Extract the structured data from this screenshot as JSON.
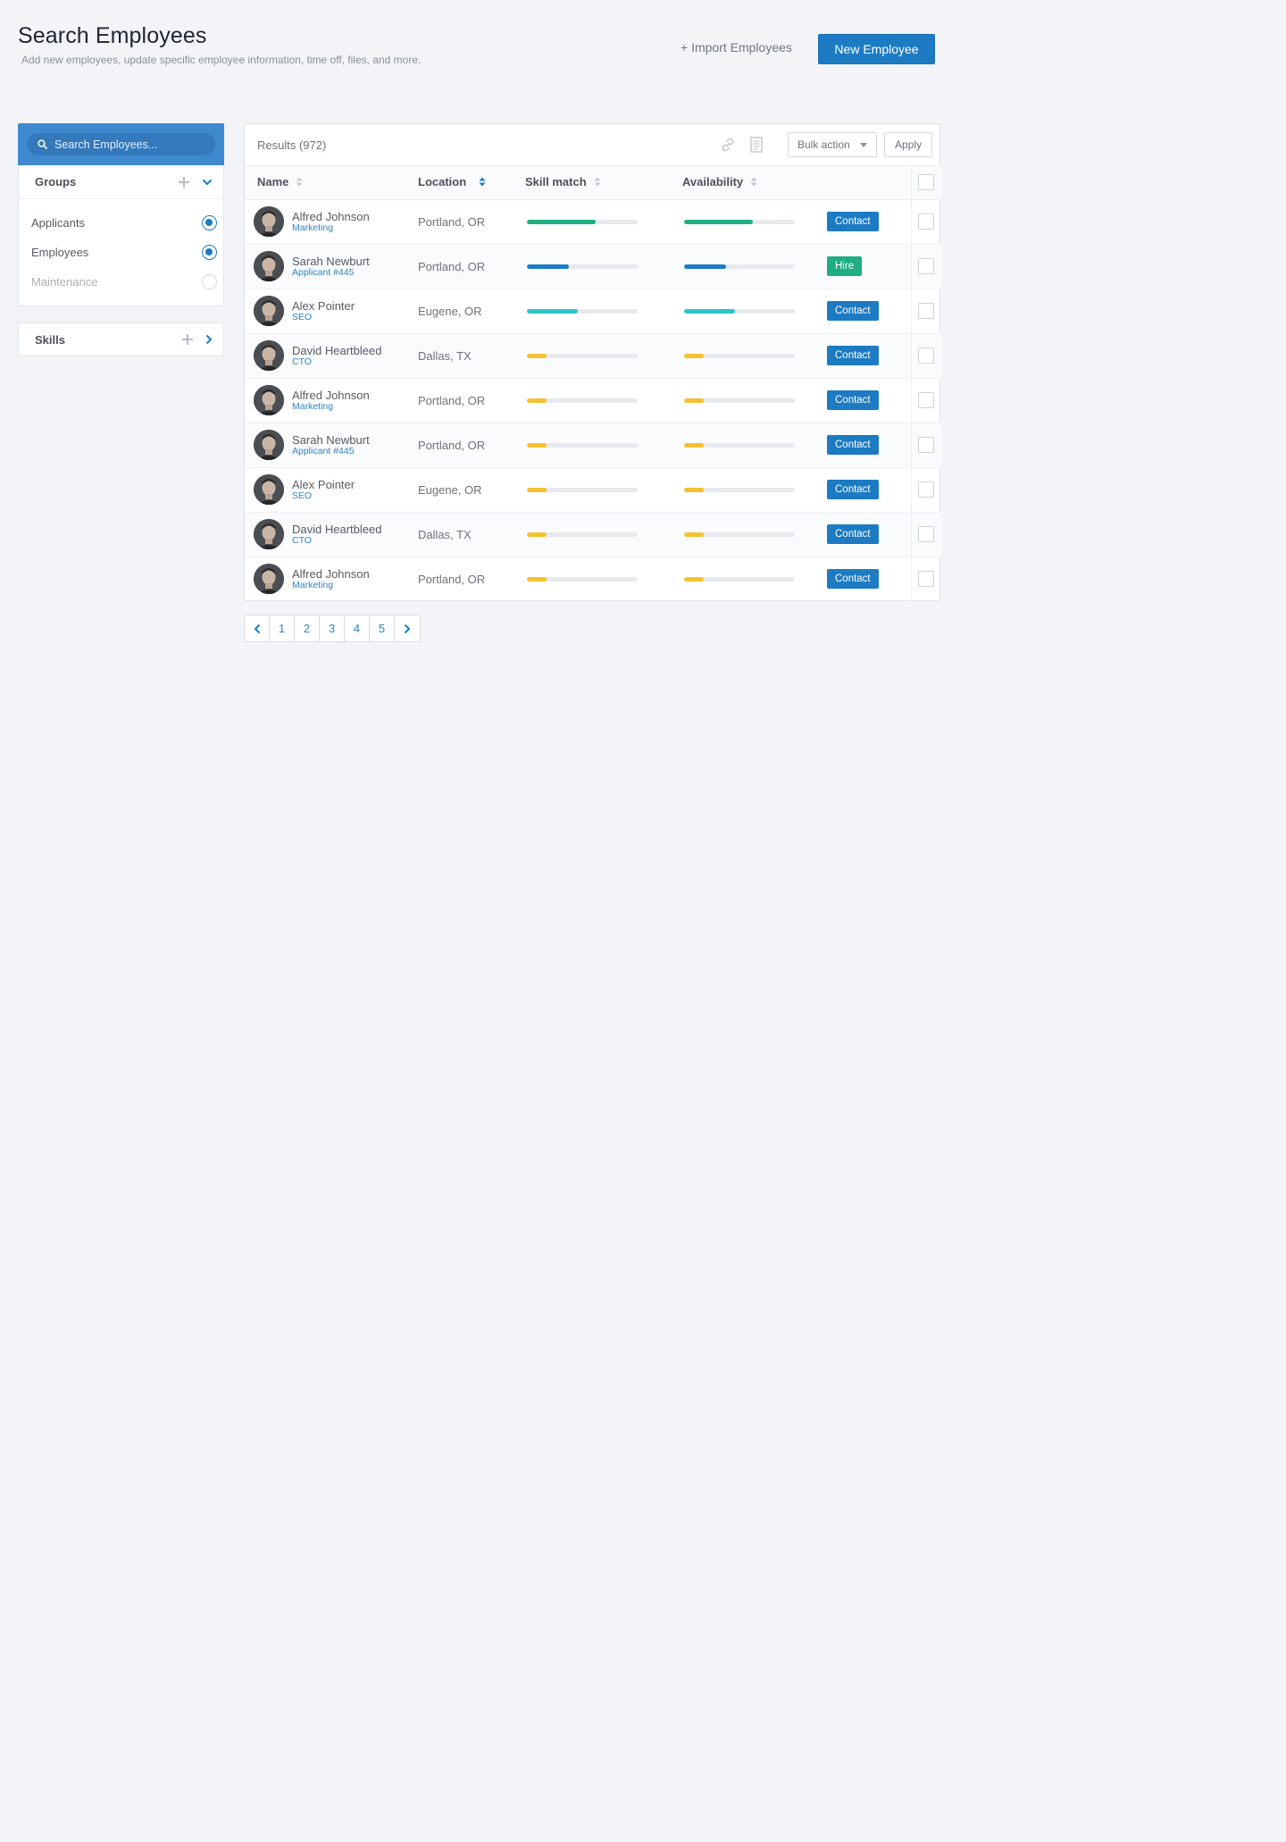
{
  "header": {
    "title": "Search Employees",
    "subtitle": "Add new employees, update specific employee information, time off, files, and more.",
    "import_label": "+ Import Employees",
    "new_label": "New Employee"
  },
  "sidebar": {
    "search_placeholder": "Search Employees...",
    "groups_title": "Groups",
    "groups": [
      {
        "label": "Applicants",
        "selected": true
      },
      {
        "label": "Employees",
        "selected": true
      },
      {
        "label": "Maintenance",
        "selected": false
      }
    ],
    "skills_title": "Skills"
  },
  "results": {
    "count_label": "Results (972)",
    "bulk_label": "Bulk action",
    "apply_label": "Apply",
    "columns": {
      "name": "Name",
      "location": "Location",
      "skill": "Skill match",
      "availability": "Availability"
    },
    "rows": [
      {
        "name": "Alfred Johnson",
        "role": "Marketing",
        "location": "Portland, OR",
        "skill": 0.62,
        "availability": 0.62,
        "color": "#1fae83",
        "action": "Contact"
      },
      {
        "name": "Sarah Newburt",
        "role": "Applicant #445",
        "location": "Portland, OR",
        "skill": 0.38,
        "availability": 0.38,
        "color": "#1c7bc3",
        "action": "Hire"
      },
      {
        "name": "Alex Pointer",
        "role": "SEO",
        "location": "Eugene, OR",
        "skill": 0.46,
        "availability": 0.46,
        "color": "#2ec4c9",
        "action": "Contact"
      },
      {
        "name": "David Heartbleed",
        "role": "CTO",
        "location": "Dallas, TX",
        "skill": 0.18,
        "availability": 0.18,
        "color": "#f5c12e",
        "action": "Contact"
      },
      {
        "name": "Alfred Johnson",
        "role": "Marketing",
        "location": "Portland, OR",
        "skill": 0.18,
        "availability": 0.18,
        "color": "#f5c12e",
        "action": "Contact"
      },
      {
        "name": "Sarah Newburt",
        "role": "Applicant #445",
        "location": "Portland, OR",
        "skill": 0.18,
        "availability": 0.18,
        "color": "#f5c12e",
        "action": "Contact"
      },
      {
        "name": "Alex Pointer",
        "role": "SEO",
        "location": "Eugene, OR",
        "skill": 0.18,
        "availability": 0.18,
        "color": "#f5c12e",
        "action": "Contact"
      },
      {
        "name": "David Heartbleed",
        "role": "CTO",
        "location": "Dallas, TX",
        "skill": 0.18,
        "availability": 0.18,
        "color": "#f5c12e",
        "action": "Contact"
      },
      {
        "name": "Alfred Johnson",
        "role": "Marketing",
        "location": "Portland, OR",
        "skill": 0.18,
        "availability": 0.18,
        "color": "#f5c12e",
        "action": "Contact"
      }
    ]
  },
  "pagination": {
    "pages": [
      "1",
      "2",
      "3",
      "4",
      "5"
    ],
    "prev_icon": "chevron-left-icon",
    "next_icon": "chevron-right-icon"
  },
  "colors": {
    "primary": "#1c7bc3",
    "success": "#1fae83",
    "teal": "#2ec4c9",
    "warning": "#f5c12e"
  }
}
